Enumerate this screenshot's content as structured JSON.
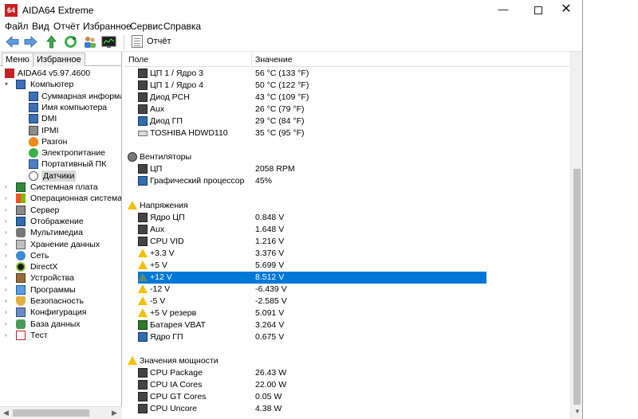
{
  "app": {
    "title": "AIDA64 Extreme",
    "icon_text": "64"
  },
  "window_controls": {
    "minimize": "—",
    "close": "✕"
  },
  "menu": [
    "Файл",
    "Вид",
    "Отчёт",
    "Избранное",
    "Сервис",
    "Справка"
  ],
  "toolbar": {
    "report_label": "Отчёт",
    "buttons": [
      "back-arrow-icon",
      "forward-arrow-icon",
      "up-arrow-icon",
      "refresh-icon",
      "users-icon",
      "monitor-chart-icon"
    ]
  },
  "left": {
    "tabs": [
      "Меню",
      "Избранное"
    ],
    "tree": [
      {
        "label": "AIDA64 v5.97.4600",
        "icon": "aida-icon",
        "level": 0
      },
      {
        "label": "Компьютер",
        "icon": "computer-icon",
        "level": 0,
        "expanded": true
      },
      {
        "label": "Суммарная информа",
        "icon": "computer-icon",
        "level": 1
      },
      {
        "label": "Имя компьютера",
        "icon": "computer-icon",
        "level": 1
      },
      {
        "label": "DMI",
        "icon": "computer-icon",
        "level": 1
      },
      {
        "label": "IPMI",
        "icon": "server-icon",
        "level": 1
      },
      {
        "label": "Разгон",
        "icon": "flame-icon",
        "level": 1
      },
      {
        "label": "Электропитание",
        "icon": "power-icon",
        "level": 1
      },
      {
        "label": "Портативный ПК",
        "icon": "laptop-icon",
        "level": 1
      },
      {
        "label": "Датчики",
        "icon": "sensor-icon",
        "level": 1,
        "selected": true
      },
      {
        "label": "Системная плата",
        "icon": "motherboard-icon",
        "level": 0
      },
      {
        "label": "Операционная система",
        "icon": "windows-icon",
        "level": 0
      },
      {
        "label": "Сервер",
        "icon": "server-icon",
        "level": 0
      },
      {
        "label": "Отображение",
        "icon": "display-icon",
        "level": 0
      },
      {
        "label": "Мультимедиа",
        "icon": "speaker-icon",
        "level": 0
      },
      {
        "label": "Хранение данных",
        "icon": "storage-icon",
        "level": 0
      },
      {
        "label": "Сеть",
        "icon": "network-icon",
        "level": 0
      },
      {
        "label": "DirectX",
        "icon": "directx-icon",
        "level": 0
      },
      {
        "label": "Устройства",
        "icon": "devices-icon",
        "level": 0
      },
      {
        "label": "Программы",
        "icon": "programs-icon",
        "level": 0
      },
      {
        "label": "Безопасность",
        "icon": "shield-icon",
        "level": 0
      },
      {
        "label": "Конфигурация",
        "icon": "config-icon",
        "level": 0
      },
      {
        "label": "База данных",
        "icon": "database-icon",
        "level": 0
      },
      {
        "label": "Тест",
        "icon": "test-icon",
        "level": 0
      }
    ]
  },
  "columns": {
    "field": "Поле",
    "value": "Значение"
  },
  "rows": [
    {
      "type": "item",
      "icon": "cpu-icon",
      "field": "ЦП 1 / Ядро 3",
      "value": "56 °C  (133 °F)"
    },
    {
      "type": "item",
      "icon": "cpu-icon",
      "field": "ЦП 1 / Ядро 4",
      "value": "50 °C  (122 °F)"
    },
    {
      "type": "item",
      "icon": "chip-icon",
      "field": "Диод PCH",
      "value": "43 °C  (109 °F)"
    },
    {
      "type": "item",
      "icon": "cpu-icon",
      "field": "Aux",
      "value": "26 °C  (79 °F)"
    },
    {
      "type": "item",
      "icon": "gpu-icon",
      "field": "Диод ГП",
      "value": "29 °C  (84 °F)"
    },
    {
      "type": "item",
      "icon": "disk-icon",
      "field": "TOSHIBA HDWD110",
      "value": "35 °C  (95 °F)"
    },
    {
      "type": "blank"
    },
    {
      "type": "group",
      "icon": "fan-icon",
      "field": "Вентиляторы"
    },
    {
      "type": "item",
      "icon": "cpu-icon",
      "field": "ЦП",
      "value": "2058 RPM"
    },
    {
      "type": "item",
      "icon": "gpu-icon",
      "field": "Графический процессор",
      "value": "45%"
    },
    {
      "type": "blank"
    },
    {
      "type": "group",
      "icon": "warning-icon",
      "field": "Напряжения"
    },
    {
      "type": "item",
      "icon": "cpu-icon",
      "field": "Ядро ЦП",
      "value": "0.848 V"
    },
    {
      "type": "item",
      "icon": "cpu-icon",
      "field": "Aux",
      "value": "1.648 V"
    },
    {
      "type": "item",
      "icon": "cpu-icon",
      "field": "CPU VID",
      "value": "1.216 V"
    },
    {
      "type": "item",
      "icon": "warning-icon",
      "field": "+3.3 V",
      "value": "3.376 V"
    },
    {
      "type": "item",
      "icon": "warning-icon",
      "field": "+5 V",
      "value": "5.699 V"
    },
    {
      "type": "item",
      "icon": "warning-icon",
      "field": "+12 V",
      "value": "8.512 V",
      "selected": true
    },
    {
      "type": "item",
      "icon": "warning-icon",
      "field": "-12 V",
      "value": "-6.439 V"
    },
    {
      "type": "item",
      "icon": "warning-icon",
      "field": "-5 V",
      "value": "-2.585 V"
    },
    {
      "type": "item",
      "icon": "warning-icon",
      "field": "+5 V резерв",
      "value": "5.091 V"
    },
    {
      "type": "item",
      "icon": "battery-icon",
      "field": "Батарея VBAT",
      "value": "3.264 V"
    },
    {
      "type": "item",
      "icon": "gpu-icon",
      "field": "Ядро ГП",
      "value": "0.675 V"
    },
    {
      "type": "blank"
    },
    {
      "type": "group",
      "icon": "warning-icon",
      "field": "Значения мощности"
    },
    {
      "type": "item",
      "icon": "cpu-icon",
      "field": "CPU Package",
      "value": "26.43 W"
    },
    {
      "type": "item",
      "icon": "cpu-icon",
      "field": "CPU IA Cores",
      "value": "22.00 W"
    },
    {
      "type": "item",
      "icon": "cpu-icon",
      "field": "CPU GT Cores",
      "value": "0.05 W"
    },
    {
      "type": "item",
      "icon": "cpu-icon",
      "field": "CPU Uncore",
      "value": "4.38 W"
    }
  ],
  "colors": {
    "selection": "#0078d7",
    "warning": "#f5c000",
    "app_icon": "#c62222"
  }
}
